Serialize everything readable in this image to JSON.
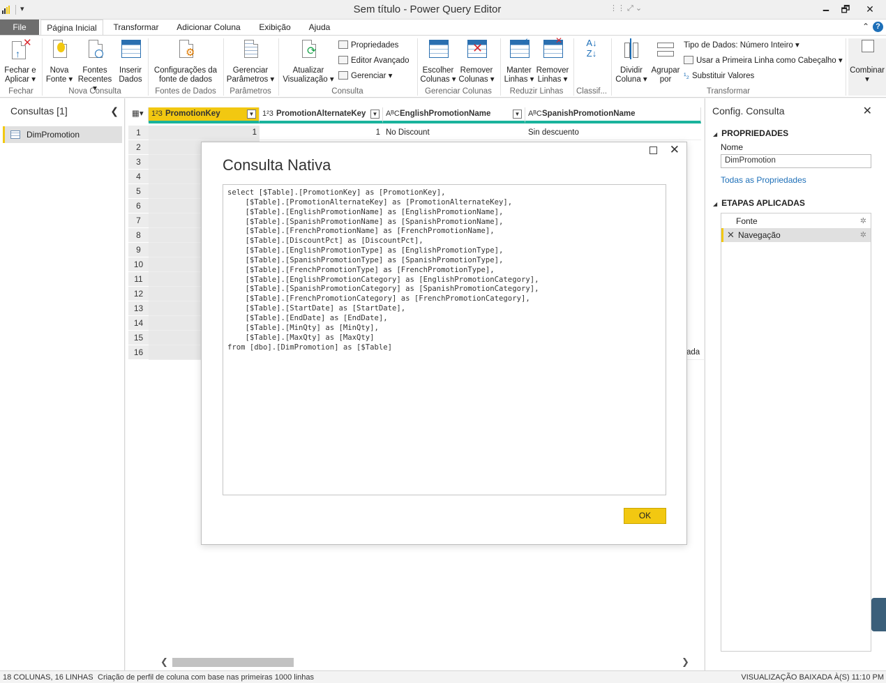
{
  "window": {
    "title": "Sem título - Power Query Editor",
    "minimize": "🗕",
    "restore": "🗗",
    "close": "✕",
    "qa": "▾"
  },
  "ribbon_tabs": [
    "File",
    "Página Inicial",
    "Transformar",
    "Adicionar Coluna",
    "Exibição",
    "Ajuda"
  ],
  "ribbon": {
    "fechar": {
      "btn": "Fechar e\nAplicar ▾",
      "group": "Fechar"
    },
    "nova_fonte": "Nova\nFonte ▾",
    "fontes_recentes": "Fontes\nRecentes ▾",
    "inserir_dados": "Inserir\nDados",
    "nova_consulta_group": "Nova Consulta",
    "config_fonte": "Configurações da\nfonte de dados",
    "fontes_group": "Fontes de Dados",
    "gerenciar_param": "Gerenciar\nParâmetros ▾",
    "param_group": "Parâmetros",
    "atualizar": "Atualizar\nVisualização ▾",
    "propriedades": "Propriedades",
    "editor_avancado": "Editor Avançado",
    "gerenciar": "Gerenciar ▾",
    "consulta_group": "Consulta",
    "escolher_colunas": "Escolher\nColunas ▾",
    "remover_colunas": "Remover\nColunas ▾",
    "gerenciar_colunas_group": "Gerenciar Colunas",
    "manter_linhas": "Manter\nLinhas ▾",
    "remover_linhas": "Remover\nLinhas ▾",
    "reduzir_group": "Reduzir Linhas",
    "classif_group": "Classif...",
    "dividir": "Dividir\nColuna ▾",
    "agrupar": "Agrupar\npor",
    "tipo_dados": "Tipo de Dados: Número Inteiro ▾",
    "primeira_linha": "Usar a Primeira Linha como Cabeçalho ▾",
    "substituir": "Substituir Valores",
    "transformar_group": "Transformar",
    "combinar": "Combinar\n▾"
  },
  "queries_pane": {
    "header": "Consultas [1]",
    "items": [
      "DimPromotion"
    ]
  },
  "grid": {
    "columns": [
      {
        "type": "1²3",
        "name": "PromotionKey"
      },
      {
        "type": "1²3",
        "name": "PromotionAlternateKey"
      },
      {
        "type": "AᴮC",
        "name": "EnglishPromotionName"
      },
      {
        "type": "AᴮC",
        "name": "SpanishPromotionName"
      }
    ],
    "row_numbers": [
      "1",
      "2",
      "3",
      "4",
      "5",
      "6",
      "7",
      "8",
      "9",
      "10",
      "11",
      "12",
      "13",
      "14",
      "15",
      "16"
    ],
    "row1": [
      "1",
      "1",
      "No Discount",
      "Sin descuento"
    ],
    "row16_tail": "ada"
  },
  "dialog": {
    "title": "Consulta Nativa",
    "sql": "select [$Table].[PromotionKey] as [PromotionKey],\n    [$Table].[PromotionAlternateKey] as [PromotionAlternateKey],\n    [$Table].[EnglishPromotionName] as [EnglishPromotionName],\n    [$Table].[SpanishPromotionName] as [SpanishPromotionName],\n    [$Table].[FrenchPromotionName] as [FrenchPromotionName],\n    [$Table].[DiscountPct] as [DiscountPct],\n    [$Table].[EnglishPromotionType] as [EnglishPromotionType],\n    [$Table].[SpanishPromotionType] as [SpanishPromotionType],\n    [$Table].[FrenchPromotionType] as [FrenchPromotionType],\n    [$Table].[EnglishPromotionCategory] as [EnglishPromotionCategory],\n    [$Table].[SpanishPromotionCategory] as [SpanishPromotionCategory],\n    [$Table].[FrenchPromotionCategory] as [FrenchPromotionCategory],\n    [$Table].[StartDate] as [StartDate],\n    [$Table].[EndDate] as [EndDate],\n    [$Table].[MinQty] as [MinQty],\n    [$Table].[MaxQty] as [MaxQty]\nfrom [dbo].[DimPromotion] as [$Table]",
    "ok": "OK"
  },
  "settings_pane": {
    "header": "Config. Consulta",
    "properties_title": "PROPRIEDADES",
    "name_label": "Nome",
    "name_value": "DimPromotion",
    "all_props": "Todas as Propriedades",
    "steps_title": "ETAPAS APLICADAS",
    "steps": [
      "Fonte",
      "Navegação"
    ]
  },
  "status": {
    "left": "18 COLUNAS, 16 LINHAS",
    "profiling": "Criação de perfil de coluna com base nas primeiras 1000 linhas",
    "right": "VISUALIZAÇÃO BAIXADA À(S) 11:10 PM"
  },
  "colors": {
    "accent": "#f2c811",
    "teal": "#1ab39c",
    "link": "#1d6fb8"
  }
}
